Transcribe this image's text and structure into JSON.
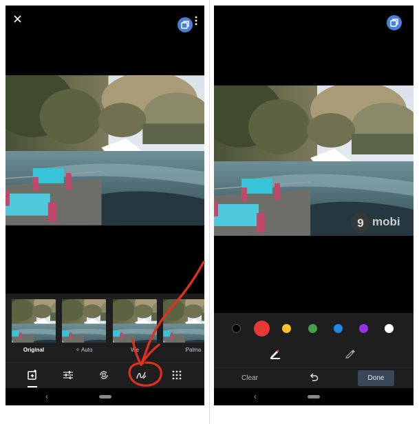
{
  "left_screen": {
    "top_bar": {
      "close_icon": "close-icon",
      "compare_icon": "compare-icon",
      "more_icon": "more-vert-icon"
    },
    "filters": [
      {
        "label": "Original"
      },
      {
        "label": "Auto"
      },
      {
        "label": "We"
      },
      {
        "label": ""
      },
      {
        "label": "Palma"
      }
    ],
    "tools": [
      {
        "icon": "suggestions-icon",
        "active": true
      },
      {
        "icon": "adjust-sliders-icon"
      },
      {
        "icon": "crop-rotate-icon"
      },
      {
        "icon": "markup-icon"
      },
      {
        "icon": "more-tools-icon"
      }
    ],
    "nav": {
      "back_glyph": "‹"
    }
  },
  "right_screen": {
    "top_bar": {
      "compare_icon": "compare-icon"
    },
    "watermark": {
      "text": "mobi",
      "prefix": "9"
    },
    "colors": [
      "#000000",
      "#e53935",
      "#fbc02d",
      "#43a047",
      "#1e88e5",
      "#9334e6",
      "#ffffff"
    ],
    "selected_color": "#e53935",
    "pens": [
      {
        "icon": "pen-icon",
        "active": true
      },
      {
        "icon": "highlighter-icon"
      }
    ],
    "actions": {
      "clear_label": "Clear",
      "done_label": "Done"
    },
    "nav": {
      "back_glyph": "‹"
    }
  },
  "annotation": {
    "color": "#e0301e"
  }
}
